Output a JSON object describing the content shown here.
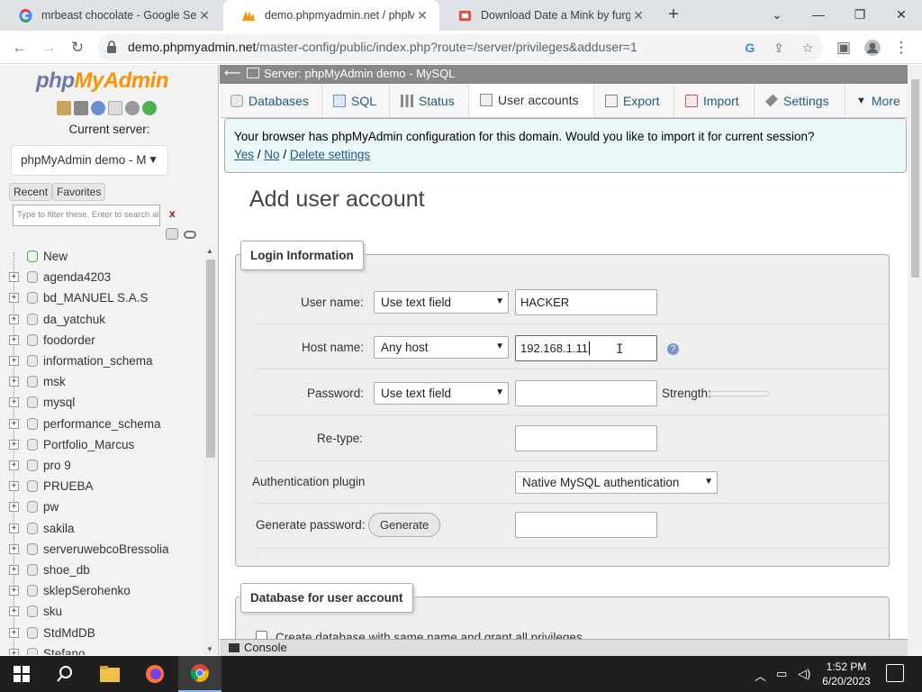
{
  "browser": {
    "tabs": [
      {
        "title": "mrbeast chocolate - Google Sear",
        "icon": "google-icon"
      },
      {
        "title": "demo.phpmyadmin.net / phpMy",
        "icon": "phpmyadmin-icon",
        "active": true
      },
      {
        "title": "Download Date a Mink by furgr",
        "icon": "download-icon"
      }
    ],
    "url_host": "demo.phpmyadmin.net",
    "url_path": "/master-config/public/index.php?route=/server/privileges&adduser=1"
  },
  "nav": {
    "logo_php": "php",
    "logo_admin": "MyAdmin",
    "current_server_label": "Current server:",
    "server_value": "phpMyAdmin demo - M",
    "recent_label": "Recent",
    "favorites_label": "Favorites",
    "filter_placeholder": "Type to filter these, Enter to search all",
    "filter_clear": "x",
    "new_label": "New",
    "databases": [
      "agenda4203",
      "bd_MANUEL S.A.S",
      "da_yatchuk",
      "foodorder",
      "information_schema",
      "msk",
      "mysql",
      "performance_schema",
      "Portfolio_Marcus",
      "pro 9",
      "PRUEBA",
      "pw",
      "sakila",
      "serveruwebcoBressolia",
      "shoe_db",
      "sklepSerohenko",
      "sku",
      "StdMdDB",
      "Stefano"
    ]
  },
  "main": {
    "breadcrumb": "Server: phpMyAdmin demo - MySQL",
    "menu": [
      {
        "label": "Databases",
        "icon": "database-icon"
      },
      {
        "label": "SQL",
        "icon": "sql-icon"
      },
      {
        "label": "Status",
        "icon": "status-icon"
      },
      {
        "label": "User accounts",
        "icon": "users-icon",
        "active": true
      },
      {
        "label": "Export",
        "icon": "export-icon"
      },
      {
        "label": "Import",
        "icon": "import-icon"
      },
      {
        "label": "Settings",
        "icon": "wrench-icon"
      },
      {
        "label": "More",
        "icon": "caret-down-icon"
      }
    ],
    "notice": {
      "message": "Your browser has phpMyAdmin configuration for this domain. Would you like to import it for current session?",
      "yes": "Yes",
      "sep1": " / ",
      "no": "No",
      "sep2": " / ",
      "delete": "Delete settings"
    },
    "title": "Add user account",
    "login": {
      "legend": "Login Information",
      "username_label": "User name:",
      "username_mode": "Use text field",
      "username_value": "HACKER",
      "hostname_label": "Host name:",
      "hostname_mode": "Any host",
      "hostname_value": "192.168.1.11",
      "password_label": "Password:",
      "password_mode": "Use text field",
      "password_value": "",
      "strength_label": "Strength:",
      "retype_label": "Re-type:",
      "auth_label": "Authentication plugin",
      "auth_value": "Native MySQL authentication",
      "generate_label": "Generate password:",
      "generate_button": "Generate"
    },
    "database": {
      "legend": "Database for user account",
      "option1": "Create database with same name and grant all privileges."
    },
    "console_label": "Console"
  },
  "taskbar": {
    "time": "1:52 PM",
    "date": "6/20/2023"
  },
  "colors": {
    "link": "#235a81",
    "logo_php": "#6c78af",
    "logo_admin": "#f89406",
    "notice_bg": "#ebf8fa"
  }
}
